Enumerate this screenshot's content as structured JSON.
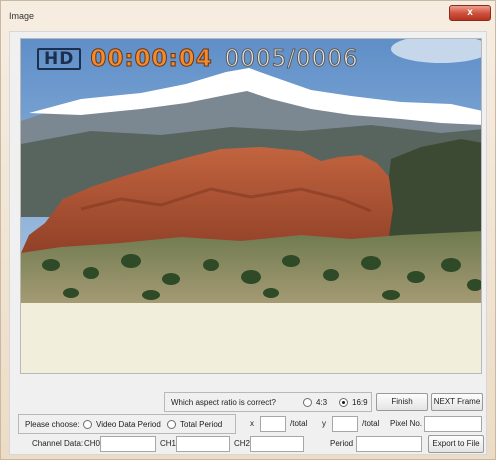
{
  "window": {
    "title": "Image",
    "close_glyph": "x"
  },
  "overlay": {
    "hd_badge": "HD",
    "timecode": "00:00:04",
    "frame_counter": "0005/0006"
  },
  "aspect": {
    "question": "Which aspect ratio is correct?",
    "options": [
      {
        "label": "4:3",
        "selected": false
      },
      {
        "label": "16:9",
        "selected": true
      }
    ]
  },
  "buttons": {
    "finish": "Finish",
    "next_frame": "NEXT Frame",
    "export": "Export to File"
  },
  "period_choice": {
    "label": "Please choose:",
    "options": [
      {
        "label": "Video Data Period",
        "selected": false
      },
      {
        "label": "Total Period",
        "selected": false
      }
    ]
  },
  "coords": {
    "x_label": "x",
    "x_total": "/total",
    "y_label": "y",
    "y_total": "/total",
    "pixel_no_label": "Pixel No."
  },
  "channel": {
    "label": "Channel Data:",
    "ch0": "CH0",
    "ch1": "CH1",
    "ch2": "CH2",
    "period_label": "Period"
  },
  "colors": {
    "timecode": "#f28a2f",
    "hd_badge": "#1d2f4f",
    "close_button": "#d0533f"
  }
}
